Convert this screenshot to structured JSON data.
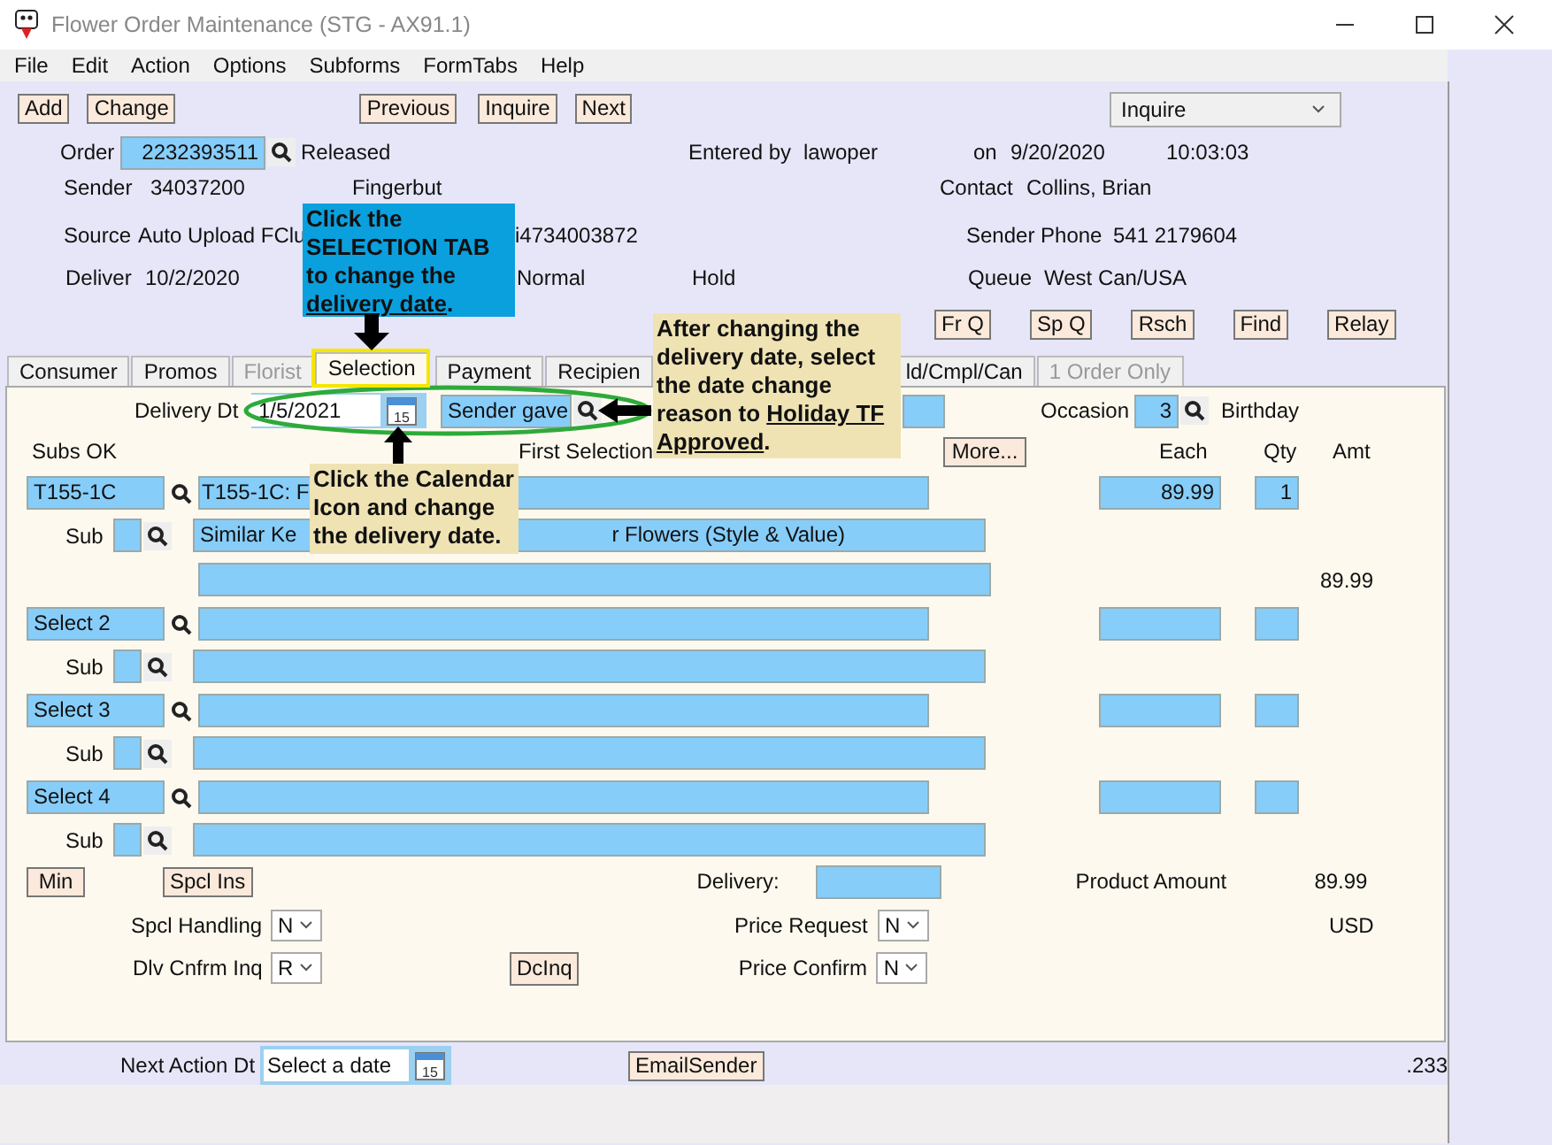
{
  "window": {
    "title": "Flower Order Maintenance (STG - AX91.1)"
  },
  "menu": [
    "File",
    "Edit",
    "Action",
    "Options",
    "Subforms",
    "FormTabs",
    "Help"
  ],
  "toolbar": {
    "buttons": [
      "Add",
      "Change",
      "Previous",
      "Inquire",
      "Next"
    ],
    "mode": "Inquire"
  },
  "header": {
    "order_label": "Order",
    "order": "2232393511",
    "status": "Released",
    "entered_by_label": "Entered by",
    "entered_by": "lawoper",
    "on_label": "on",
    "date": "9/20/2020",
    "time": "10:03:03",
    "sender_label": "Sender",
    "sender": "34037200",
    "sender_name": "Fingerbut",
    "contact_label": "Contact",
    "contact": "Collins, Brian",
    "source_label": "Source",
    "source": "Auto Upload FClu",
    "source_ref": "i4734003872",
    "phone_label": "Sender Phone",
    "phone": "541 2179604",
    "deliver_label": "Deliver",
    "deliver": "10/2/2020",
    "priority": "Normal",
    "hold": "Hold",
    "queue_label": "Queue",
    "queue": "West Can/USA"
  },
  "queue_buttons": [
    "Fr Q",
    "Sp Q",
    "Rsch",
    "Find",
    "Relay"
  ],
  "tabs": [
    {
      "label": "Consumer",
      "selected": false,
      "disabled": false
    },
    {
      "label": "Promos",
      "selected": false,
      "disabled": false
    },
    {
      "label": "Florist",
      "selected": false,
      "disabled": true
    },
    {
      "label": "Selection",
      "selected": true,
      "disabled": false
    },
    {
      "label": "Payment",
      "selected": false,
      "disabled": false
    },
    {
      "label": "Recipien",
      "selected": false,
      "disabled": false
    },
    {
      "label": "ld/Cmpl/Can",
      "selected": false,
      "disabled": false
    },
    {
      "label": "1 Order Only",
      "selected": false,
      "disabled": true
    }
  ],
  "selection": {
    "delivery_dt_label": "Delivery Dt",
    "delivery_dt": "1/5/2021",
    "calendar_day": "15",
    "reason": "Sender gave",
    "occasion_label": "Occasion",
    "occasion": "3",
    "occasion_name": "Birthday",
    "subs_ok_label": "Subs OK",
    "first_selection_label": "First Selection",
    "more_button": "More...",
    "columns": [
      "Each",
      "Qty",
      "Amt"
    ],
    "items": [
      {
        "code": "T155-1C",
        "description": "T155-1C: F",
        "each": "89.99",
        "qty": "1",
        "sub_label": "Sub",
        "sub_description": [
          "Similar Ke",
          "r Flowers (Style & Value)"
        ],
        "amount": "89.99"
      },
      {
        "code": "Select 2",
        "sub_label": "Sub"
      },
      {
        "code": "Select 3",
        "sub_label": "Sub"
      },
      {
        "code": "Select 4",
        "sub_label": "Sub"
      }
    ]
  },
  "totals": {
    "min_button": "Min",
    "spcl_ins_button": "Spcl Ins",
    "delivery_label": "Delivery:",
    "product_amount_label": "Product Amount",
    "product_amount": "89.99",
    "spcl_handling_label": "Spcl Handling",
    "spcl_handling": "N",
    "price_request_label": "Price Request",
    "price_request": "N",
    "currency": "USD",
    "dlv_cnfrm_label": "Dlv Cnfrm Inq",
    "dlv_cnfrm": "R",
    "dcinq_button": "DcInq",
    "price_confirm_label": "Price Confirm",
    "price_confirm": "N"
  },
  "footer": {
    "next_action_label": "Next Action Dt",
    "next_action_placeholder": "Select a date",
    "calendar_day": "15",
    "email_button": "EmailSender",
    "code": ".233"
  },
  "callouts": [
    {
      "kind": "blue",
      "text": "Click the SELECTION TAB to change the ",
      "underlined": "delivery date",
      "after": "."
    },
    {
      "kind": "tan",
      "text": "After changing the delivery date, select the date change reason to ",
      "underlined": "Holiday TF Approved",
      "after": "."
    },
    {
      "kind": "tan",
      "text": "Click the Calendar Icon and change the delivery date."
    }
  ]
}
